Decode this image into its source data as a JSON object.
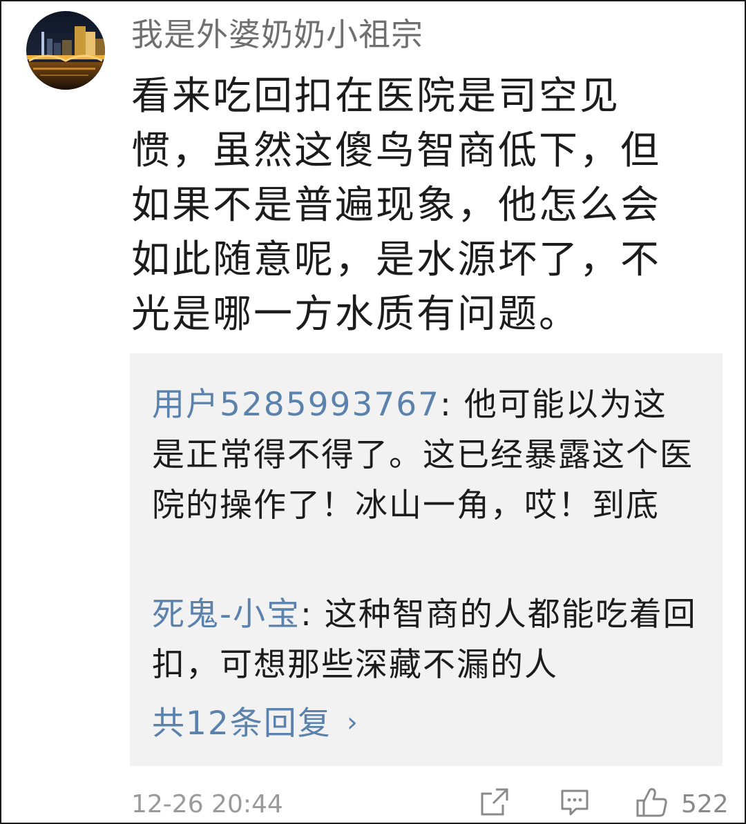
{
  "comment": {
    "username": "我是外婆奶奶小祖宗",
    "text": "看来吃回扣在医院是司空见惯，虽然这傻鸟智商低下，但如果不是普遍现象，他怎么会如此随意呢，是水源坏了，不光是哪一方水质有问题。",
    "timestamp": "12-26 20:44",
    "like_count": "522"
  },
  "replies": [
    {
      "author": "用户5285993767",
      "separator": ": ",
      "text": "他可能以为这是正常得不得了。这已经暴露这个医院的操作了！冰山一角，哎！到底"
    },
    {
      "author": "死鬼-小宝",
      "separator": ": ",
      "text": "这种智商的人都能吃着回扣，可想那些深藏不漏的人"
    }
  ],
  "more_replies": {
    "label": "共12条回复",
    "chevron": "›"
  },
  "icons": {
    "avatar": "avatar-night-city-icon",
    "share": "share-icon",
    "comment": "comment-icon",
    "like": "thumbs-up-icon"
  },
  "colors": {
    "username": "#6f6f6f",
    "link": "#5b82ad",
    "reply_background": "#f2f2f2",
    "meta": "#9a9a9a"
  }
}
